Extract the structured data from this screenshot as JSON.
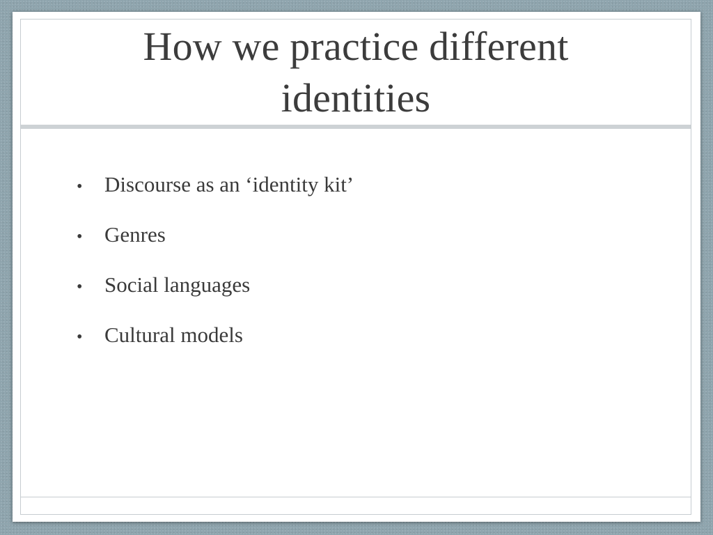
{
  "slide": {
    "title": "How we practice different identities",
    "bullets": [
      "Discourse as an ‘identity kit’",
      "Genres",
      "Social languages",
      "Cultural models"
    ],
    "bullet_glyph": "•"
  },
  "theme": {
    "background": "#8fa5ae",
    "slide": "#ffffff",
    "title_color": "#3c3c3c",
    "text_color": "#3a3a3a",
    "rule_color": "#cdd2d5"
  }
}
